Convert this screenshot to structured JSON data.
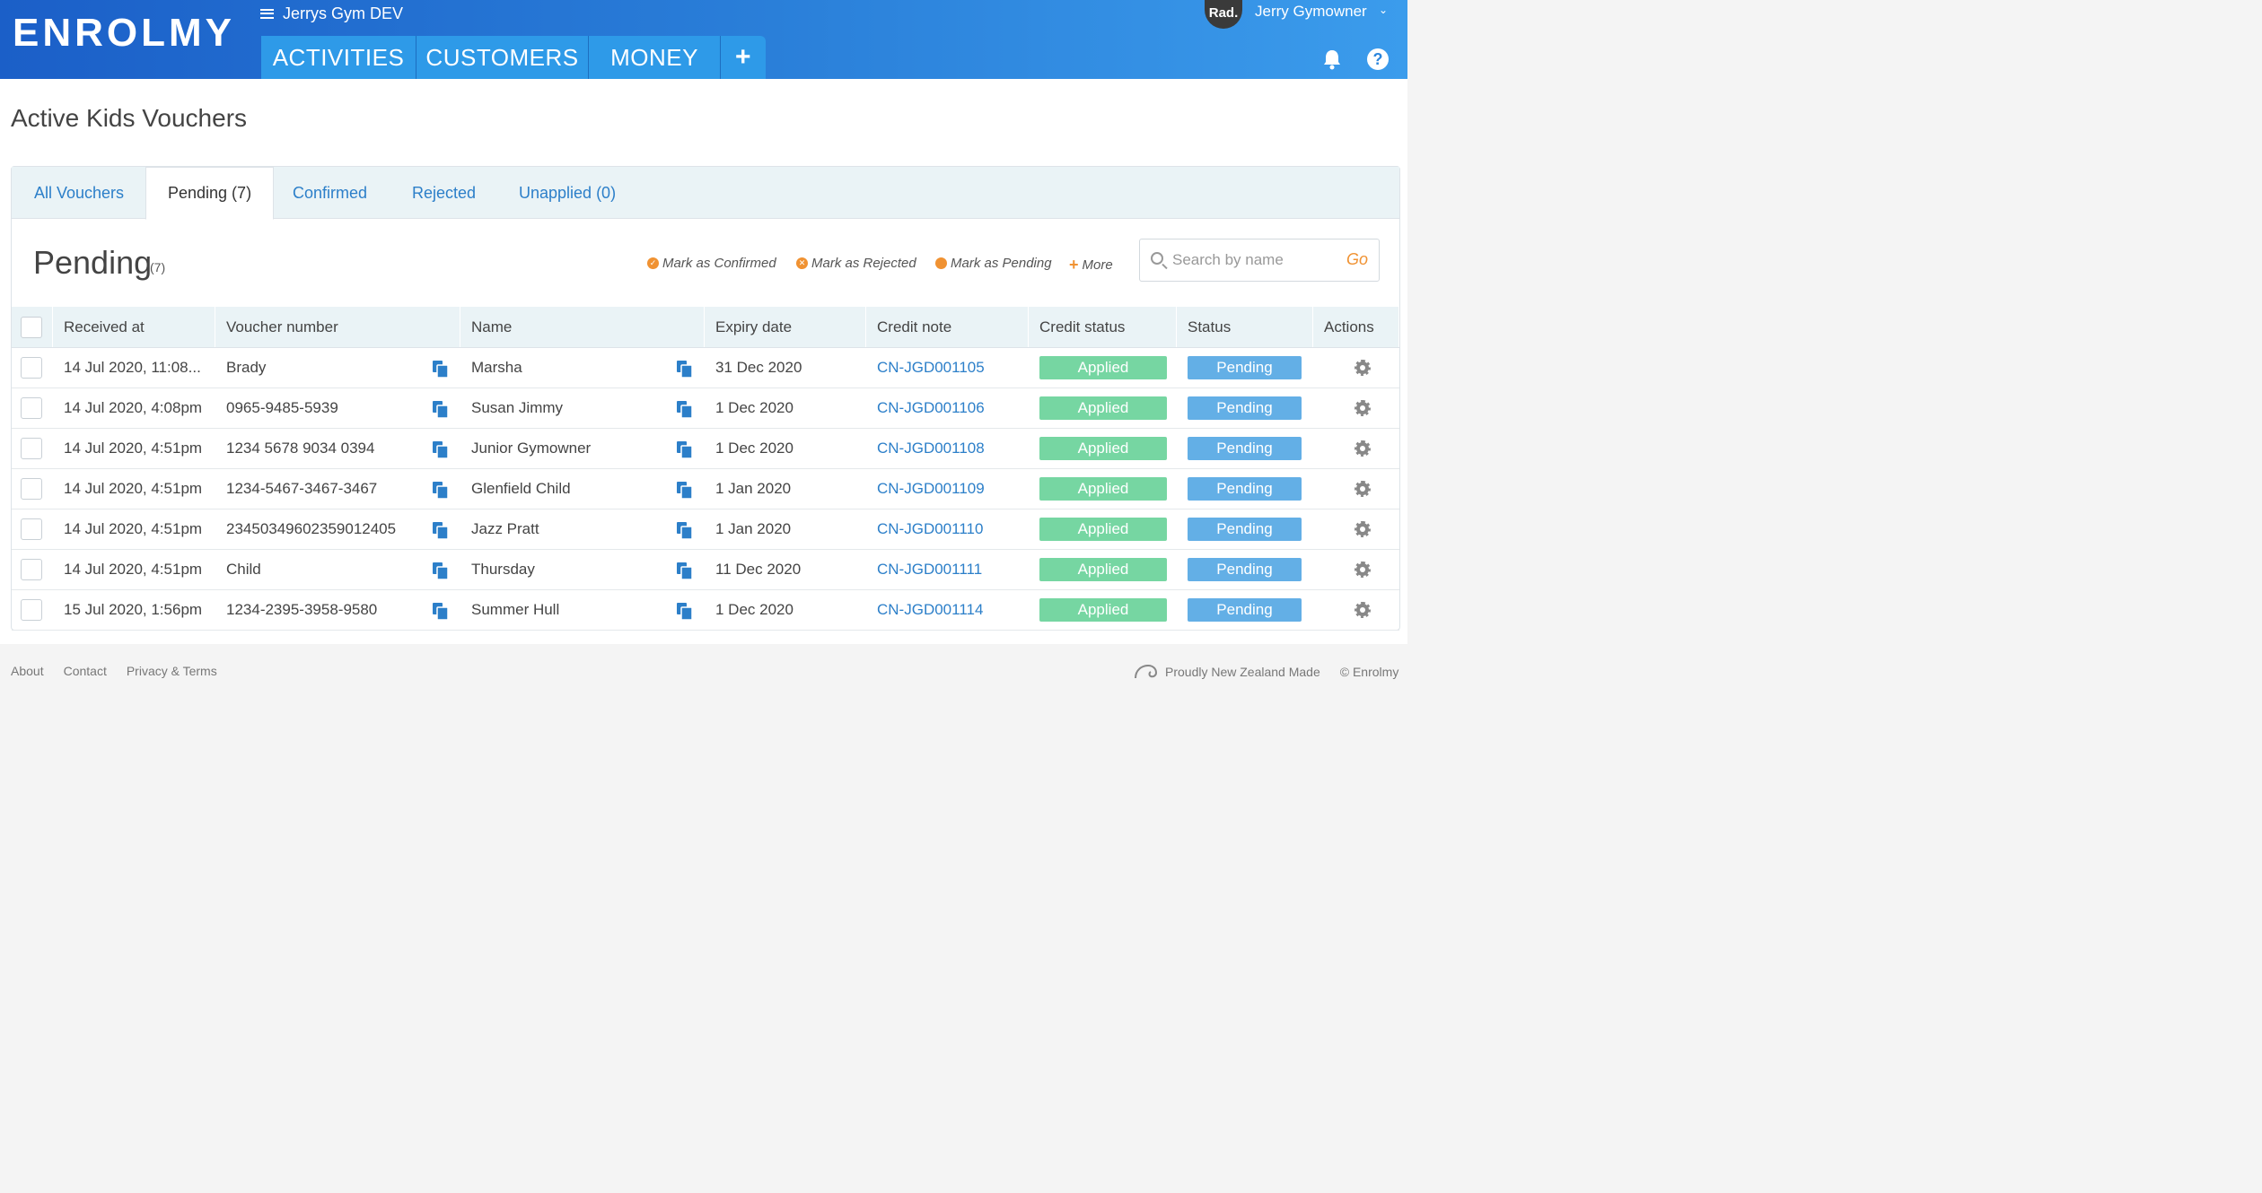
{
  "brand": {
    "logo": "ENROLMY"
  },
  "header": {
    "org_name": "Jerrys Gym DEV",
    "nav": [
      "ACTIVITIES",
      "CUSTOMERS",
      "MONEY"
    ],
    "add_label": "+",
    "avatar_text": "Rad.",
    "user_name": "Jerry Gymowner",
    "help_label": "?"
  },
  "page": {
    "title": "Active Kids Vouchers"
  },
  "tabs": [
    {
      "label": "All Vouchers",
      "active": false
    },
    {
      "label": "Pending (7)",
      "active": true
    },
    {
      "label": "Confirmed",
      "active": false
    },
    {
      "label": "Rejected",
      "active": false
    },
    {
      "label": "Unapplied (0)",
      "active": false
    }
  ],
  "section": {
    "title": "Pending",
    "count": "(7)",
    "actions": {
      "confirm": "Mark as Confirmed",
      "reject": "Mark as Rejected",
      "pending": "Mark as Pending",
      "more": "More"
    },
    "search": {
      "placeholder": "Search by name",
      "go": "Go"
    }
  },
  "table": {
    "columns": [
      "Received at",
      "Voucher number",
      "Name",
      "Expiry date",
      "Credit note",
      "Credit status",
      "Status",
      "Actions"
    ],
    "rows": [
      {
        "received": "14 Jul 2020, 11:08...",
        "voucher": "Brady",
        "name": "Marsha",
        "expiry": "31 Dec 2020",
        "credit_note": "CN-JGD001105",
        "credit_status": "Applied",
        "status": "Pending"
      },
      {
        "received": "14 Jul 2020, 4:08pm",
        "voucher": "0965-9485-5939",
        "name": "Susan Jimmy",
        "expiry": "1 Dec 2020",
        "credit_note": "CN-JGD001106",
        "credit_status": "Applied",
        "status": "Pending"
      },
      {
        "received": "14 Jul 2020, 4:51pm",
        "voucher": "1234 5678 9034 0394",
        "name": "Junior Gymowner",
        "expiry": "1 Dec 2020",
        "credit_note": "CN-JGD001108",
        "credit_status": "Applied",
        "status": "Pending"
      },
      {
        "received": "14 Jul 2020, 4:51pm",
        "voucher": "1234-5467-3467-3467",
        "name": "Glenfield Child",
        "expiry": "1 Jan 2020",
        "credit_note": "CN-JGD001109",
        "credit_status": "Applied",
        "status": "Pending"
      },
      {
        "received": "14 Jul 2020, 4:51pm",
        "voucher": "23450349602359012405",
        "name": "Jazz Pratt",
        "expiry": "1 Jan 2020",
        "credit_note": "CN-JGD001110",
        "credit_status": "Applied",
        "status": "Pending"
      },
      {
        "received": "14 Jul 2020, 4:51pm",
        "voucher": "Child",
        "name": "Thursday",
        "expiry": "11 Dec 2020",
        "credit_note": "CN-JGD001111",
        "credit_status": "Applied",
        "status": "Pending"
      },
      {
        "received": "15 Jul 2020, 1:56pm",
        "voucher": "1234-2395-3958-9580",
        "name": "Summer Hull",
        "expiry": "1 Dec 2020",
        "credit_note": "CN-JGD001114",
        "credit_status": "Applied",
        "status": "Pending"
      }
    ]
  },
  "footer": {
    "links": [
      "About",
      "Contact",
      "Privacy & Terms"
    ],
    "made_in": "Proudly New Zealand Made",
    "copyright": "© Enrolmy"
  },
  "colors": {
    "accent": "#f09232",
    "link": "#2c7fc9",
    "applied": "#76d6a2",
    "pending": "#63afe6",
    "header_start": "#1b5fc8",
    "header_end": "#3b9cec"
  },
  "icons": [
    "menu-icon",
    "plus-icon",
    "bell-icon",
    "help-icon",
    "check-circle-icon",
    "x-circle-icon",
    "dot-icon",
    "search-icon",
    "copy-icon",
    "gear-icon",
    "fern-icon"
  ]
}
